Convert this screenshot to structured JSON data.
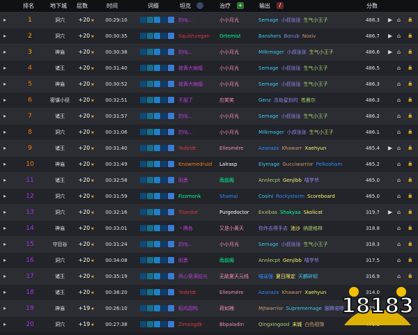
{
  "header": {
    "rank": "排名",
    "dungeon": "地下城",
    "level": "层数",
    "time": "时间",
    "affixes": "词缀",
    "tank": "坦克",
    "heal": "治疗",
    "dps": "输出",
    "score": "分数"
  },
  "icons": {
    "expand": "▸",
    "star": "★",
    "home": "⌂",
    "video": "▶",
    "lock": "🔒",
    "dungeon": "▲",
    "tank": "shield-icon",
    "heal": "plus-icon",
    "dps": "sword-icon",
    "heal_glyph": "+",
    "dps_glyph": "/"
  },
  "affix_colors": [
    "#0d4a78",
    "#136f8b",
    "#1d80c8",
    "#0f3d6b",
    "#3a7bd5"
  ],
  "rows": [
    {
      "rank": "1",
      "rank_color": "#ffb000",
      "dungeon": "洞穴",
      "level": "+20",
      "time": "00:29:10",
      "tank": "豹咕...",
      "tank_cls": "cls-dh",
      "heal": "小小月光",
      "heal_cls": "cls-pal",
      "dps": [
        {
          "n": "Semage",
          "c": "cls-mage"
        },
        {
          "n": "小叔张张",
          "c": "cls-lock"
        },
        {
          "n": "生气小王子",
          "c": "cls-hun"
        }
      ],
      "score": "488.3",
      "icons": [
        "home",
        "video",
        "lock"
      ]
    },
    {
      "rank": "2",
      "rank_color": "#ffb000",
      "dungeon": "洞穴",
      "level": "+20",
      "time": "00:30:35",
      "tank": "Squishvegan",
      "tank_cls": "cls-dk",
      "heal": "Ortemist",
      "heal_cls": "cls-monk",
      "dps": [
        {
          "n": "Banshers",
          "c": "cls-mage"
        },
        {
          "n": "Bonub",
          "c": "cls-lock"
        },
        {
          "n": "Noxiv",
          "c": "cls-war"
        }
      ],
      "score": "486.7",
      "icons": [
        "video",
        "home",
        "lock"
      ]
    },
    {
      "rank": "3",
      "rank_color": "#ffb000",
      "dungeon": "神庙",
      "level": "+20",
      "time": "00:30:38",
      "tank": "豹咕...",
      "tank_cls": "cls-dh",
      "heal": "小小月光",
      "heal_cls": "cls-pal",
      "dps": [
        {
          "n": "Milkmager",
          "c": "cls-mage"
        },
        {
          "n": "小叔张张",
          "c": "cls-lock"
        },
        {
          "n": "生气小王子",
          "c": "cls-hun"
        }
      ],
      "score": "486.6",
      "icons": [
        "home",
        "video",
        "lock"
      ]
    },
    {
      "rank": "4",
      "rank_color": "#ff7d0a",
      "dungeon": "诸王",
      "level": "+20",
      "time": "00:31:40",
      "tank": "被黄大蝙蝠",
      "tank_cls": "cls-dh",
      "heal": "小小月光",
      "heal_cls": "cls-pal",
      "dps": [
        {
          "n": "Semage",
          "c": "cls-mage"
        },
        {
          "n": "小叔张张",
          "c": "cls-lock"
        },
        {
          "n": "生气小王子",
          "c": "cls-hun"
        }
      ],
      "score": "486.5",
      "icons": [
        "home",
        "lock"
      ]
    },
    {
      "rank": "5",
      "rank_color": "#ff7d0a",
      "dungeon": "神庙",
      "level": "+20",
      "time": "00:30:52",
      "tank": "被黄大蝙蝠",
      "tank_cls": "cls-dh",
      "heal": "小小月光",
      "heal_cls": "cls-pal",
      "dps": [
        {
          "n": "Semage",
          "c": "cls-mage"
        },
        {
          "n": "小叔张张",
          "c": "cls-lock"
        },
        {
          "n": "生气小王子",
          "c": "cls-hun"
        }
      ],
      "score": "486.3",
      "icons": [
        "home",
        "lock"
      ]
    },
    {
      "rank": "6",
      "rank_color": "#ff7d0a",
      "dungeon": "密谋小径",
      "level": "+20",
      "time": "00:32:51",
      "tank": "不服了",
      "tank_cls": "cls-dh",
      "heal": "应笑笑",
      "heal_cls": "cls-pal",
      "dps": [
        {
          "n": "Genz",
          "c": "cls-mage"
        },
        {
          "n": "冻劫星封的",
          "c": "cls-lock"
        },
        {
          "n": "苍晨尔",
          "c": "cls-hun"
        }
      ],
      "score": "486.3",
      "icons": [
        "home",
        "lock"
      ]
    },
    {
      "rank": "7",
      "rank_color": "#ff7d0a",
      "dungeon": "诸王",
      "level": "+20",
      "time": "00:31:57",
      "tank": "豹咕...",
      "tank_cls": "cls-dh",
      "heal": "小小月光",
      "heal_cls": "cls-pal",
      "dps": [
        {
          "n": "Semage",
          "c": "cls-mage"
        },
        {
          "n": "小叔张张",
          "c": "cls-lock"
        },
        {
          "n": "生气小王子",
          "c": "cls-hun"
        }
      ],
      "score": "486.2",
      "icons": [
        "home",
        "lock"
      ]
    },
    {
      "rank": "8",
      "rank_color": "#ff7d0a",
      "dungeon": "洞穴",
      "level": "+20",
      "time": "00:31:06",
      "tank": "豹咕...",
      "tank_cls": "cls-dh",
      "heal": "小小月光",
      "heal_cls": "cls-pal",
      "dps": [
        {
          "n": "Milkmager",
          "c": "cls-mage"
        },
        {
          "n": "小叔张张",
          "c": "cls-lock"
        },
        {
          "n": "生气小王子",
          "c": "cls-hun"
        }
      ],
      "score": "486.1",
      "icons": [
        "home",
        "lock"
      ]
    },
    {
      "rank": "9",
      "rank_color": "#ff7d0a",
      "dungeon": "诸王",
      "level": "+20",
      "time": "00:31:40",
      "tank": "Yodeldt",
      "tank_cls": "cls-dk",
      "heal": "Eliesmére",
      "heal_cls": "cls-pal",
      "dps": [
        {
          "n": "Azunazx",
          "c": "cls-sha"
        },
        {
          "n": "Khawarr",
          "c": "cls-war"
        },
        {
          "n": "Xaehyun",
          "c": "cls-rog"
        }
      ],
      "score": "485.4",
      "icons": [
        "video",
        "home",
        "lock"
      ]
    },
    {
      "rank": "10",
      "rank_color": "#ff7d0a",
      "dungeon": "神庙",
      "level": "+20",
      "time": "00:31:49",
      "tank": "Knowmedruid",
      "tank_cls": "cls-dru",
      "heal": "Lalrasp",
      "heal_cls": "cls-pri",
      "dps": [
        {
          "n": "Elymage",
          "c": "cls-mage"
        },
        {
          "n": "Gucciwarrior",
          "c": "cls-war"
        },
        {
          "n": "Pelkosham",
          "c": "cls-sha"
        }
      ],
      "score": "485.2",
      "icons": [
        "home",
        "lock"
      ]
    },
    {
      "rank": "11",
      "rank_color": "#a335ee",
      "dungeon": "诸王",
      "level": "+20",
      "time": "00:32:58",
      "tank": "刚勇",
      "tank_cls": "cls-dh",
      "heal": "雨前阁",
      "heal_cls": "cls-monk",
      "dps": [
        {
          "n": "Annlecpt",
          "c": "cls-hun"
        },
        {
          "n": "Genjibb",
          "c": "cls-rog"
        },
        {
          "n": "嘻学爷",
          "c": "cls-lock"
        }
      ],
      "score": "485.0",
      "icons": [
        "home",
        "lock"
      ]
    },
    {
      "rank": "12",
      "rank_color": "#a335ee",
      "dungeon": "洞穴",
      "level": "+20",
      "time": "00:31:59",
      "tank": "Fizzmonk",
      "tank_cls": "cls-monk",
      "heal": "Shamai",
      "heal_cls": "cls-sha",
      "dps": [
        {
          "n": "Cosini",
          "c": "cls-mage"
        },
        {
          "n": "Rockystorm",
          "c": "cls-sha"
        },
        {
          "n": "Scoreboard",
          "c": "cls-rog"
        }
      ],
      "score": "485.0",
      "icons": [
        "home",
        "lock"
      ]
    },
    {
      "rank": "13",
      "rank_color": "#a335ee",
      "dungeon": "洞穴",
      "level": "+20",
      "time": "00:32:16",
      "tank": "Tilandot",
      "tank_cls": "cls-dk",
      "heal": "Purgedoctor",
      "heal_cls": "cls-pri",
      "dps": [
        {
          "n": "Exxibas",
          "c": "cls-hun"
        },
        {
          "n": "Shakyaa",
          "c": "cls-monk"
        },
        {
          "n": "Skolicat",
          "c": "cls-rog"
        }
      ],
      "score": "319.7",
      "icons": [
        "video",
        "home",
        "lock"
      ]
    },
    {
      "rank": "14",
      "rank_color": "#a335ee",
      "dungeon": "神庙",
      "level": "+20",
      "time": "00:33:01",
      "tank": "丶腾各",
      "tank_cls": "cls-dh",
      "heal": "又是小黄天",
      "heal_cls": "cls-pal",
      "dps": [
        {
          "n": "你炸去得手去",
          "c": "cls-lock"
        },
        {
          "n": "池沙",
          "c": "cls-rog"
        },
        {
          "n": "纳提格林",
          "c": "cls-hun"
        }
      ],
      "score": "318.8",
      "icons": [
        "home",
        "lock"
      ]
    },
    {
      "rank": "15",
      "rank_color": "#a335ee",
      "dungeon": "守目谷",
      "level": "+20",
      "time": "00:31:24",
      "tank": "豹咕...",
      "tank_cls": "cls-dh",
      "heal": "小小月光",
      "heal_cls": "cls-pal",
      "dps": [
        {
          "n": "Semage",
          "c": "cls-mage"
        },
        {
          "n": "小叔张张",
          "c": "cls-lock"
        },
        {
          "n": "生气小王子",
          "c": "cls-hun"
        }
      ],
      "score": "318.3",
      "icons": [
        "home",
        "lock"
      ]
    },
    {
      "rank": "16",
      "rank_color": "#a335ee",
      "dungeon": "洞穴",
      "level": "+20",
      "time": "00:34:08",
      "tank": "刚勇",
      "tank_cls": "cls-dh",
      "heal": "雨前阁",
      "heal_cls": "cls-monk",
      "dps": [
        {
          "n": "Annlecpt",
          "c": "cls-hun"
        },
        {
          "n": "Genjibb",
          "c": "cls-rog"
        },
        {
          "n": "嘻学爷",
          "c": "cls-lock"
        }
      ],
      "score": "317.5",
      "icons": [
        "home",
        "lock"
      ]
    },
    {
      "rank": "17",
      "rank_color": "#a335ee",
      "dungeon": "诸王",
      "level": "+20",
      "time": "00:35:19",
      "tank": "丙心祭满铅光",
      "tank_cls": "cls-dh",
      "heal": "无敌夏天元线",
      "heal_cls": "cls-pal",
      "dps": [
        {
          "n": "喵逞强",
          "c": "cls-sha"
        },
        {
          "n": "夏日限定",
          "c": "cls-rog"
        },
        {
          "n": "天麟碎韧",
          "c": "cls-mage"
        }
      ],
      "score": "316.9",
      "icons": [
        "home",
        "lock"
      ]
    },
    {
      "rank": "18",
      "rank_color": "#a335ee",
      "dungeon": "诸王",
      "level": "+20",
      "time": "00:38:20",
      "tank": "Yodeldt",
      "tank_cls": "cls-dk",
      "heal": "Eliesmére",
      "heal_cls": "cls-pal",
      "dps": [
        {
          "n": "Azunazx",
          "c": "cls-sha"
        },
        {
          "n": "Khawarr",
          "c": "cls-war"
        },
        {
          "n": "Xaehyun",
          "c": "cls-rog"
        }
      ],
      "score": "314.0",
      "icons": []
    },
    {
      "rank": "19",
      "rank_color": "#a335ee",
      "dungeon": "神庙",
      "level": "+19",
      "time": "00:26:10",
      "tank": "稻鸡圆鸭",
      "tank_cls": "cls-dh",
      "heal": "荷如辣",
      "heal_cls": "cls-pal",
      "dps": [
        {
          "n": "Mjtwarrior",
          "c": "cls-war"
        },
        {
          "n": "Suprememage",
          "c": "cls-mage"
        },
        {
          "n": "服腾诺哦",
          "c": "cls-lock"
        }
      ],
      "score": "475.9",
      "icons": []
    },
    {
      "rank": "20",
      "rank_color": "#a335ee",
      "dungeon": "洞穴",
      "level": "+19",
      "time": "00:27:38",
      "tank": "Zimsngdk",
      "tank_cls": "cls-dk",
      "heal": "Bbpaladin",
      "heal_cls": "cls-pal",
      "dps": [
        {
          "n": "Qingxingood",
          "c": "cls-hun"
        },
        {
          "n": "末城",
          "c": "cls-rog"
        },
        {
          "n": "白色相簿",
          "c": "cls-war"
        }
      ],
      "score": "475.1",
      "icons": []
    }
  ],
  "watermark": {
    "text": "18183"
  }
}
